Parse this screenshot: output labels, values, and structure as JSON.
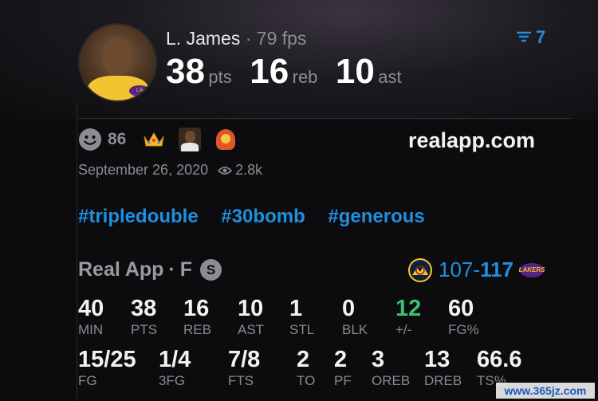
{
  "player": {
    "name": "L. James",
    "fps": "79 fps",
    "separator": "·"
  },
  "headline_stats": [
    {
      "value": "38",
      "unit": "pts"
    },
    {
      "value": "16",
      "unit": "reb"
    },
    {
      "value": "10",
      "unit": "ast"
    }
  ],
  "filter": {
    "count": "7"
  },
  "reactions": {
    "count": "86"
  },
  "site": "realapp.com",
  "date": "September 26, 2020",
  "views": "2.8k",
  "hashtags": [
    "#tripledouble",
    "#30bomb",
    "#generous"
  ],
  "game": {
    "source": "Real App",
    "position": "F",
    "badge": "S",
    "score_away": "107",
    "score_sep": "-",
    "score_home": "117"
  },
  "stats_row1": [
    {
      "value": "40",
      "label": "MIN"
    },
    {
      "value": "38",
      "label": "PTS"
    },
    {
      "value": "16",
      "label": "REB"
    },
    {
      "value": "10",
      "label": "AST"
    },
    {
      "value": "1",
      "label": "STL"
    },
    {
      "value": "0",
      "label": "BLK"
    },
    {
      "value": "12",
      "label": "+/-"
    },
    {
      "value": "60",
      "label": "FG%"
    }
  ],
  "stats_row2": [
    {
      "value": "15/25",
      "label": "FG"
    },
    {
      "value": "1/4",
      "label": "3FG"
    },
    {
      "value": "7/8",
      "label": "FTS"
    },
    {
      "value": "2",
      "label": "TO"
    },
    {
      "value": "2",
      "label": "PF"
    },
    {
      "value": "3",
      "label": "OREB"
    },
    {
      "value": "13",
      "label": "DREB"
    },
    {
      "value": "66.6",
      "label": "TS%"
    }
  ],
  "watermark": "www.365jz.com",
  "colors": {
    "accent_blue": "#1f8fe0",
    "plus_minus_green": "#3fbf6f",
    "lakers_purple": "#552583",
    "lakers_gold": "#fdb927",
    "nuggets_navy": "#0e2240"
  },
  "icons": [
    "filter-icon",
    "smiley-icon",
    "crown-icon",
    "player-emoji-icon",
    "hooded-emoji-icon",
    "eye-icon",
    "nuggets-logo-icon",
    "lakers-logo-icon",
    "starter-badge"
  ]
}
